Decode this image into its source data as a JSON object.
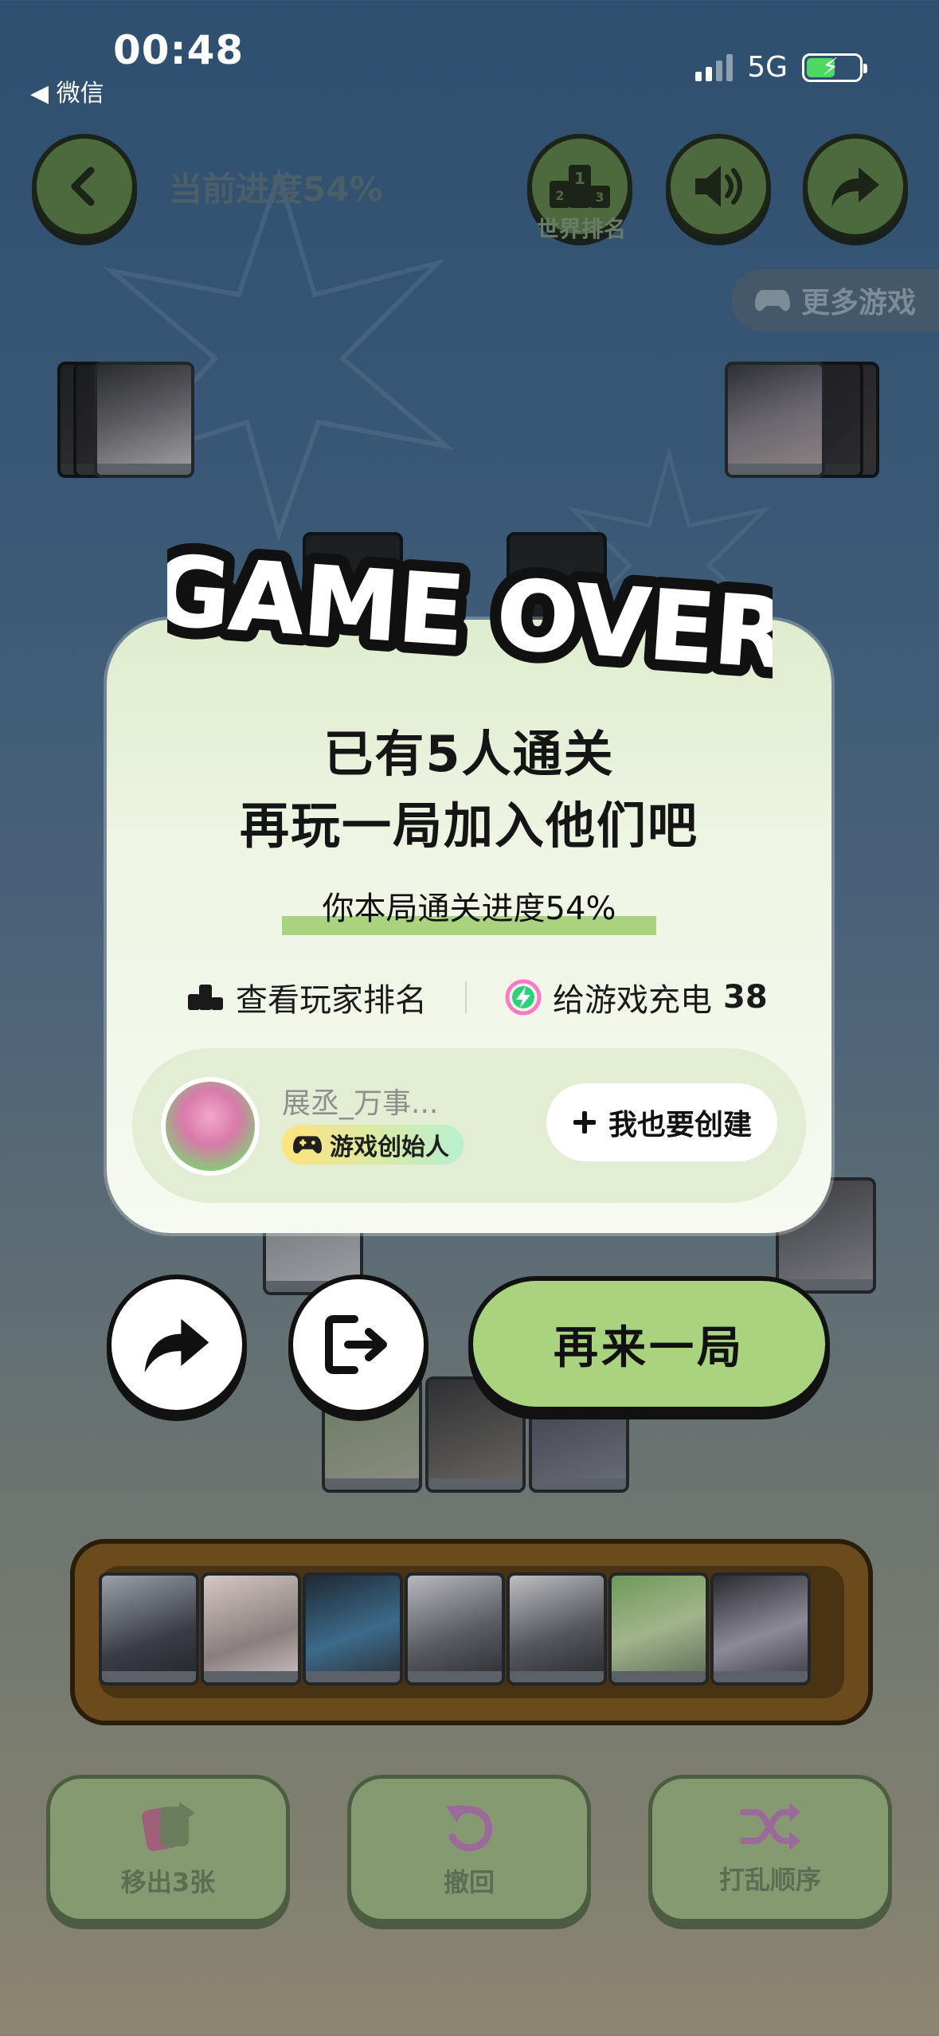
{
  "status_bar": {
    "time": "00:48",
    "back_app": "◀ 微信",
    "network": "5G"
  },
  "header": {
    "progress_label": "当前进度54%",
    "rank_label": "世界排名",
    "more_games_label": "更多游戏"
  },
  "toolbar": {
    "move_out_label": "移出3张",
    "undo_label": "撤回",
    "shuffle_label": "打乱顺序"
  },
  "modal": {
    "banner": "GAME OVER",
    "headline_1": "已有5人通关",
    "headline_2": "再玩一局加入他们吧",
    "round_progress": "你本局通关进度54%",
    "view_rank_label": "查看玩家排名",
    "charge_label": "给游戏充电",
    "charge_count": "38",
    "creator": {
      "name": "展丞_万事...",
      "badge": "游戏创始人",
      "create_button": "我也要创建"
    },
    "play_again_label": "再来一局"
  },
  "colors": {
    "accent_green": "#a9d37e",
    "modal_bg": "#eef5e4",
    "tray_brown": "#6b4a1b"
  }
}
